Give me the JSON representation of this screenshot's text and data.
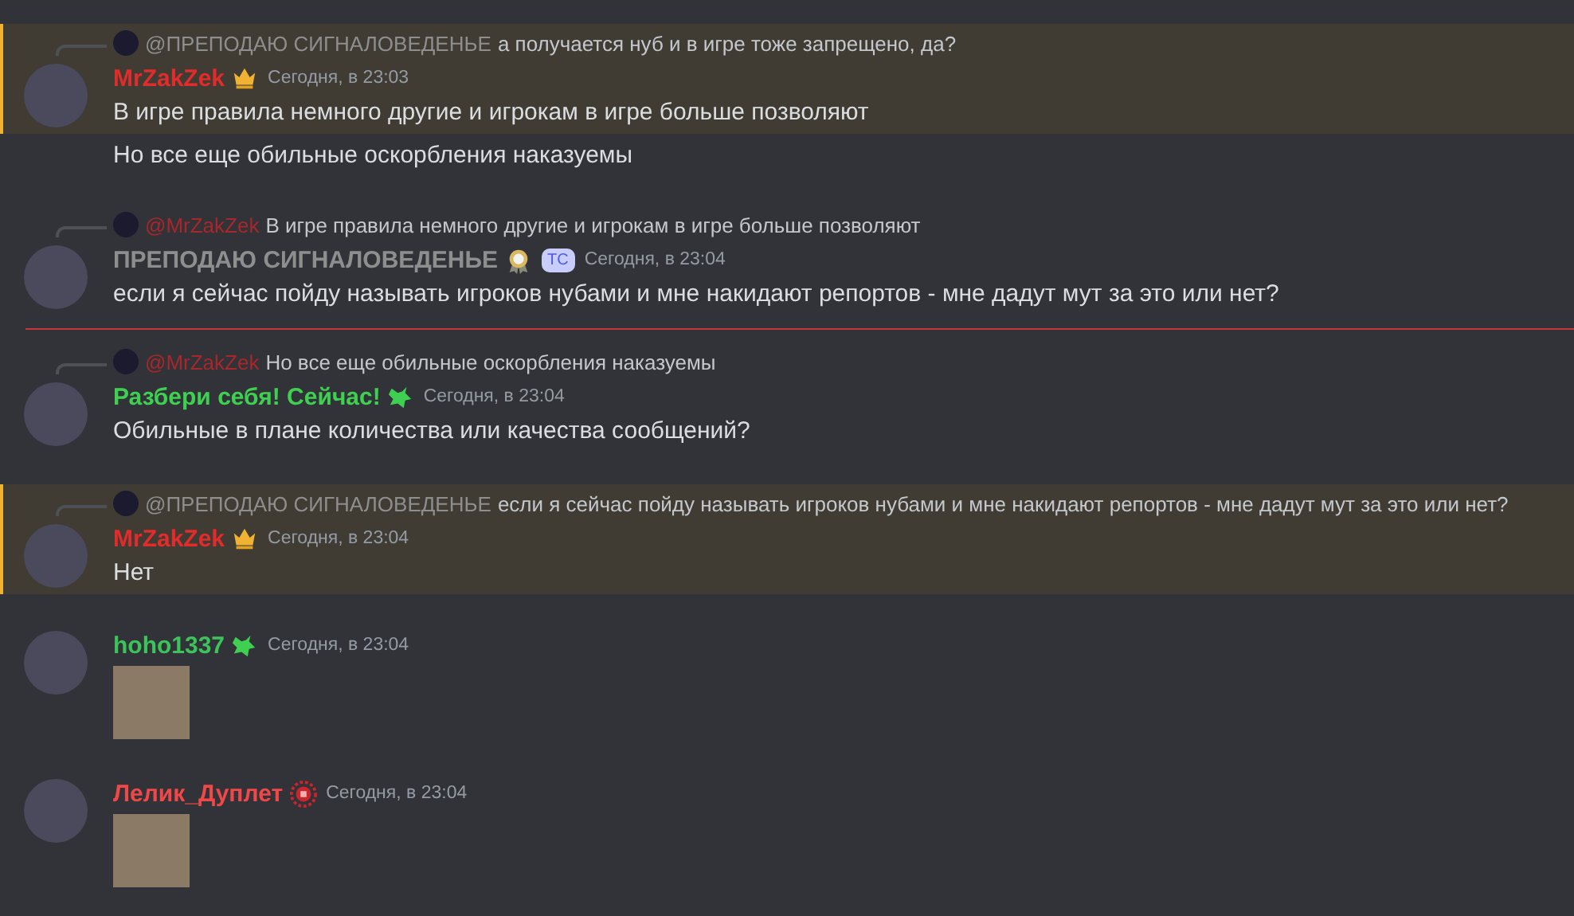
{
  "messages": [
    {
      "kind": "message",
      "highlighted": true,
      "reply": {
        "author": "@ПРЕПОДАЮ СИГНАЛОВЕДЕНЬЕ",
        "color": "#8e8e8e",
        "text": "а получается нуб и в игре тоже запрещено, да?"
      },
      "author": "MrZakZek",
      "color": "#e22b2b",
      "badge": {
        "kind": "crown"
      },
      "time": "Сегодня, в 23:03",
      "text": "В игре правила немного другие и игрокам в игре больше позволяют"
    },
    {
      "kind": "continuation",
      "highlighted": false,
      "text": "Но все еще обильные оскорбления наказуемы"
    },
    {
      "kind": "message",
      "highlighted": false,
      "reply": {
        "author": "@MrZakZek",
        "color": "#a8272b",
        "text": "В игре правила немного другие и игрокам в игре больше позволяют"
      },
      "author": "ПРЕПОДАЮ СИГНАЛОВЕДЕНЬЕ",
      "color": "#8e8e8e",
      "badge": {
        "kind": "medal"
      },
      "tag": "ТС",
      "time": "Сегодня, в 23:04",
      "text": "если я сейчас пойду называть игроков нубами и мне накидают репортов - мне дадут мут за это или нет?"
    },
    {
      "kind": "divider"
    },
    {
      "kind": "message",
      "highlighted": false,
      "reply": {
        "author": "@MrZakZek",
        "color": "#a8272b",
        "text": "Но все еще обильные оскорбления наказуемы"
      },
      "author": "Разбери себя! Сейчас!",
      "color": "#3fd052",
      "badge": {
        "kind": "wolf"
      },
      "time": "Сегодня, в 23:04",
      "text": "Обильные в плане количества или качества сообщений?"
    },
    {
      "kind": "message",
      "highlighted": true,
      "reply": {
        "author": "@ПРЕПОДАЮ СИГНАЛОВЕДЕНЬЕ",
        "color": "#8e8e8e",
        "text": "если я сейчас пойду называть игроков нубами и мне накидают репортов - мне дадут мут за это или нет?"
      },
      "author": "MrZakZek",
      "color": "#e22b2b",
      "badge": {
        "kind": "crown"
      },
      "time": "Сегодня, в 23:04",
      "text": "Нет"
    },
    {
      "kind": "message",
      "highlighted": false,
      "author": "hoho1337",
      "color": "#3cc45a",
      "badge": {
        "kind": "wolf"
      },
      "time": "Сегодня, в 23:04",
      "sticker": true
    },
    {
      "kind": "message",
      "highlighted": false,
      "author": "Лелик_Дуплет",
      "color": "#f04848",
      "badge": {
        "kind": "shield"
      },
      "time": "Сегодня, в 23:04",
      "sticker": true
    }
  ]
}
